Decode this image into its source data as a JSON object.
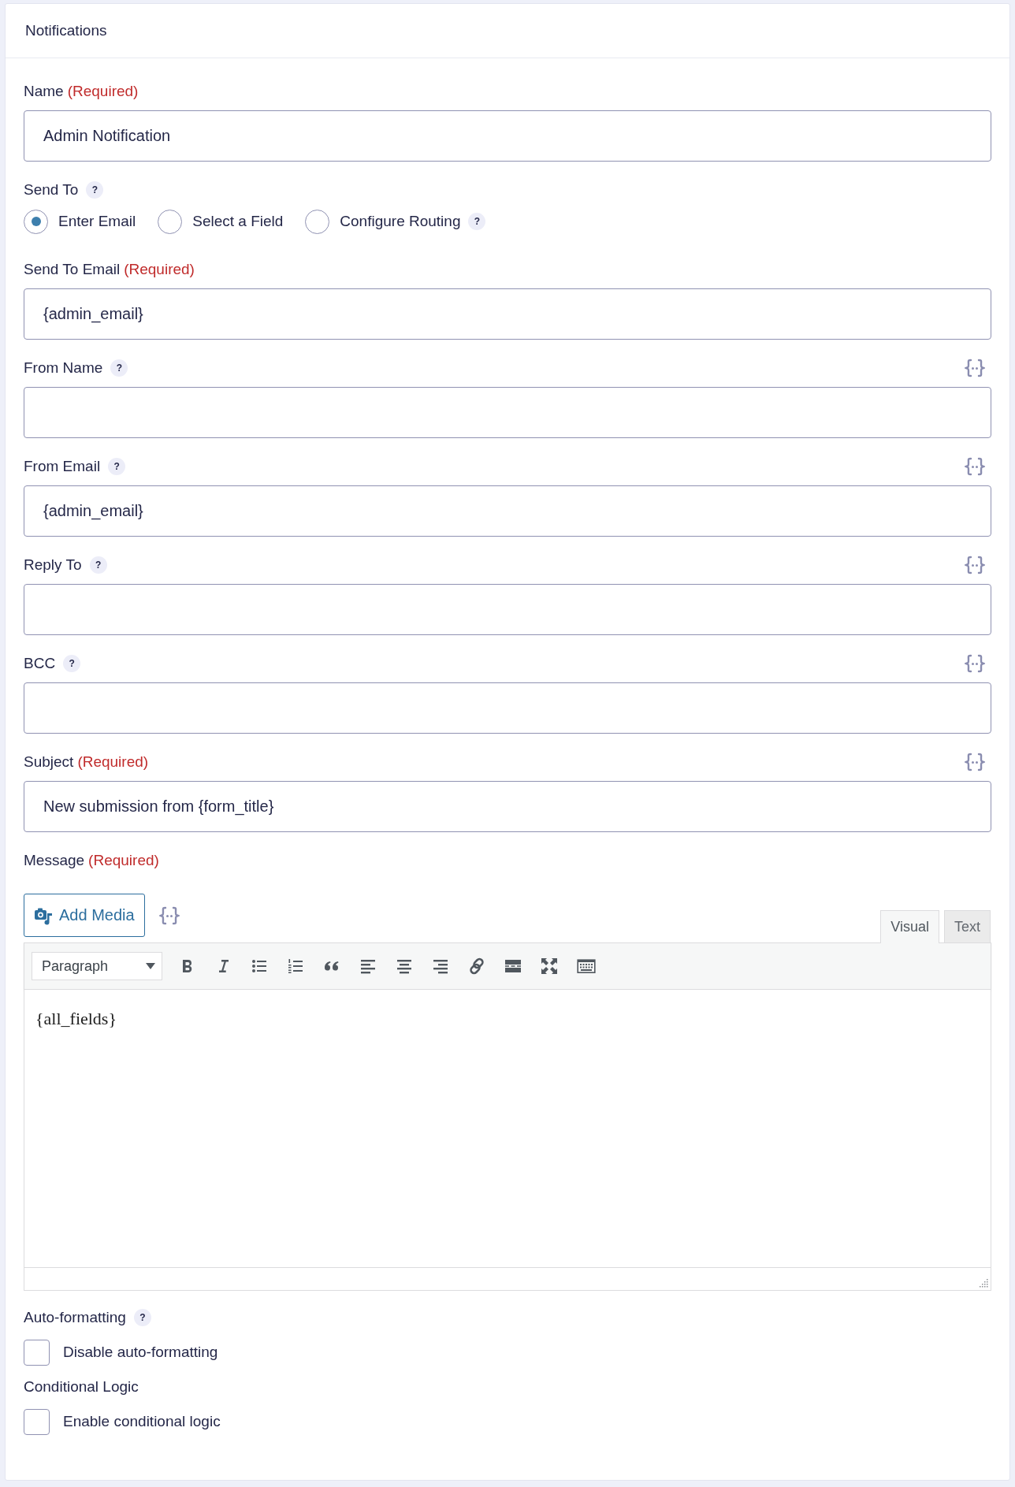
{
  "panel": {
    "title": "Notifications"
  },
  "fields": [
    {
      "kind": "text",
      "label": "Name",
      "required_mark": "(Required)",
      "value": "Admin Notification"
    },
    {
      "kind": "radio",
      "label": "Send To",
      "help": "?",
      "options": [
        {
          "label": "Enter Email",
          "selected": true
        },
        {
          "label": "Select a Field",
          "selected": false
        },
        {
          "label": "Configure Routing",
          "selected": false,
          "help": "?"
        }
      ]
    },
    {
      "kind": "text",
      "label": "Send To Email",
      "required_mark": "(Required)",
      "value": "{admin_email}"
    },
    {
      "kind": "text",
      "label": "From Name",
      "help": "?",
      "merge_tags": true
    },
    {
      "kind": "text",
      "label": "From Email",
      "help": "?",
      "merge_tags": true,
      "value": "{admin_email}"
    },
    {
      "kind": "text",
      "label": "Reply To",
      "help": "?",
      "merge_tags": true
    },
    {
      "kind": "text",
      "label": "BCC",
      "help": "?",
      "merge_tags": true
    },
    {
      "kind": "text",
      "label": "Subject",
      "required_mark": "(Required)",
      "merge_tags": true,
      "value": "New submission from {form_title}"
    },
    {
      "kind": "editor",
      "label": "Message",
      "required_mark": "(Required)",
      "add_media": "Add Media",
      "merge_tags": true,
      "tabs": [
        {
          "label": "Visual",
          "selected": true
        },
        {
          "label": "Text",
          "selected": false
        }
      ],
      "format": "Paragraph",
      "content": "{all_fields}"
    },
    {
      "kind": "checkbox",
      "label": "Auto-formatting",
      "help": "?",
      "option": {
        "label": "Disable auto-formatting",
        "checked": false
      }
    },
    {
      "kind": "checkbox",
      "label": "Conditional Logic",
      "option": {
        "label": "Enable conditional logic",
        "checked": false
      }
    }
  ]
}
